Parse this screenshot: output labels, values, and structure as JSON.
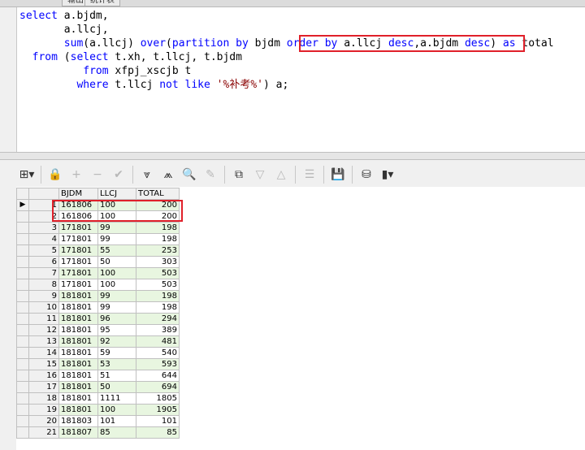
{
  "top_tabs": [
    "输出",
    "统计表"
  ],
  "sql": {
    "lines": [
      {
        "segments": [
          {
            "t": "select",
            "c": "kw"
          },
          {
            "t": " a.bjdm,",
            "c": "plain"
          }
        ]
      },
      {
        "segments": [
          {
            "t": "       a.llcj,",
            "c": "plain"
          }
        ]
      },
      {
        "segments": [
          {
            "t": "       ",
            "c": "plain"
          },
          {
            "t": "sum",
            "c": "fn"
          },
          {
            "t": "(a.llcj) ",
            "c": "plain"
          },
          {
            "t": "over",
            "c": "kw"
          },
          {
            "t": "(",
            "c": "plain"
          },
          {
            "t": "partition by",
            "c": "kw"
          },
          {
            "t": " bjdm ",
            "c": "plain"
          },
          {
            "t": "order by",
            "c": "kw"
          },
          {
            "t": " a.llcj ",
            "c": "plain"
          },
          {
            "t": "desc",
            "c": "kw"
          },
          {
            "t": ",a.bjdm ",
            "c": "plain"
          },
          {
            "t": "desc",
            "c": "kw"
          },
          {
            "t": ") ",
            "c": "plain"
          },
          {
            "t": "as",
            "c": "kw"
          },
          {
            "t": " total",
            "c": "plain"
          }
        ]
      },
      {
        "segments": [
          {
            "t": "  ",
            "c": "plain"
          },
          {
            "t": "from",
            "c": "kw"
          },
          {
            "t": " (",
            "c": "plain"
          },
          {
            "t": "select",
            "c": "kw"
          },
          {
            "t": " t.xh, t.llcj, t.bjdm",
            "c": "plain"
          }
        ]
      },
      {
        "segments": [
          {
            "t": "          ",
            "c": "plain"
          },
          {
            "t": "from",
            "c": "kw"
          },
          {
            "t": " xfpj_xscjb t",
            "c": "plain"
          }
        ]
      },
      {
        "segments": [
          {
            "t": "         ",
            "c": "plain"
          },
          {
            "t": "where",
            "c": "kw"
          },
          {
            "t": " t.llcj ",
            "c": "plain"
          },
          {
            "t": "not like",
            "c": "kw"
          },
          {
            "t": " ",
            "c": "plain"
          },
          {
            "t": "'%补考%'",
            "c": "str"
          },
          {
            "t": ") a;",
            "c": "plain"
          }
        ]
      }
    ]
  },
  "toolbar": {
    "icons": [
      {
        "name": "grid-menu-icon",
        "glyph": "⊞▾",
        "enabled": true
      },
      {
        "sep": true
      },
      {
        "name": "lock-icon",
        "glyph": "🔒",
        "enabled": true
      },
      {
        "name": "add-row-icon",
        "glyph": "+",
        "enabled": false
      },
      {
        "name": "delete-row-icon",
        "glyph": "−",
        "enabled": false
      },
      {
        "name": "post-changes-icon",
        "glyph": "✔",
        "enabled": false
      },
      {
        "sep": true
      },
      {
        "name": "fetch-next-icon",
        "glyph": "⩔",
        "enabled": true
      },
      {
        "name": "fetch-all-icon",
        "glyph": "⩕",
        "enabled": true
      },
      {
        "name": "find-icon",
        "glyph": "🔍",
        "enabled": true
      },
      {
        "name": "clear-icon",
        "glyph": "✎",
        "enabled": false
      },
      {
        "sep": true
      },
      {
        "name": "query-by-example-icon",
        "glyph": "⧉",
        "enabled": true
      },
      {
        "name": "next-record-icon",
        "glyph": "▽",
        "enabled": false
      },
      {
        "name": "previous-record-icon",
        "glyph": "△",
        "enabled": false
      },
      {
        "sep": true
      },
      {
        "name": "single-record-view-icon",
        "glyph": "☰",
        "enabled": false
      },
      {
        "sep": true
      },
      {
        "name": "save-icon",
        "glyph": "💾",
        "enabled": true
      },
      {
        "sep": true
      },
      {
        "name": "export-icon",
        "glyph": "⛁",
        "enabled": true
      },
      {
        "name": "chart-icon",
        "glyph": "▮▾",
        "enabled": true
      }
    ]
  },
  "grid": {
    "columns": [
      "BJDM",
      "LLCJ",
      "TOTAL"
    ],
    "current_row_indicator": "▶",
    "rows": [
      {
        "n": "1",
        "bjdm": "161806",
        "llcj": "100",
        "total": "200"
      },
      {
        "n": "2",
        "bjdm": "161806",
        "llcj": "100",
        "total": "200"
      },
      {
        "n": "3",
        "bjdm": "171801",
        "llcj": "99",
        "total": "198"
      },
      {
        "n": "4",
        "bjdm": "171801",
        "llcj": "99",
        "total": "198"
      },
      {
        "n": "5",
        "bjdm": "171801",
        "llcj": "55",
        "total": "253"
      },
      {
        "n": "6",
        "bjdm": "171801",
        "llcj": "50",
        "total": "303"
      },
      {
        "n": "7",
        "bjdm": "171801",
        "llcj": "100",
        "total": "503"
      },
      {
        "n": "8",
        "bjdm": "171801",
        "llcj": "100",
        "total": "503"
      },
      {
        "n": "9",
        "bjdm": "181801",
        "llcj": "99",
        "total": "198"
      },
      {
        "n": "10",
        "bjdm": "181801",
        "llcj": "99",
        "total": "198"
      },
      {
        "n": "11",
        "bjdm": "181801",
        "llcj": "96",
        "total": "294"
      },
      {
        "n": "12",
        "bjdm": "181801",
        "llcj": "95",
        "total": "389"
      },
      {
        "n": "13",
        "bjdm": "181801",
        "llcj": "92",
        "total": "481"
      },
      {
        "n": "14",
        "bjdm": "181801",
        "llcj": "59",
        "total": "540"
      },
      {
        "n": "15",
        "bjdm": "181801",
        "llcj": "53",
        "total": "593"
      },
      {
        "n": "16",
        "bjdm": "181801",
        "llcj": "51",
        "total": "644"
      },
      {
        "n": "17",
        "bjdm": "181801",
        "llcj": "50",
        "total": "694"
      },
      {
        "n": "18",
        "bjdm": "181801",
        "llcj": "1111",
        "total": "1805"
      },
      {
        "n": "19",
        "bjdm": "181801",
        "llcj": "100",
        "total": "1905"
      },
      {
        "n": "20",
        "bjdm": "181803",
        "llcj": "101",
        "total": "101"
      },
      {
        "n": "21",
        "bjdm": "181807",
        "llcj": "85",
        "total": "85"
      }
    ]
  },
  "colors": {
    "highlight_box": "#e0202a",
    "alt_row": "#e8f6e0",
    "keyword": "#0000ff"
  }
}
